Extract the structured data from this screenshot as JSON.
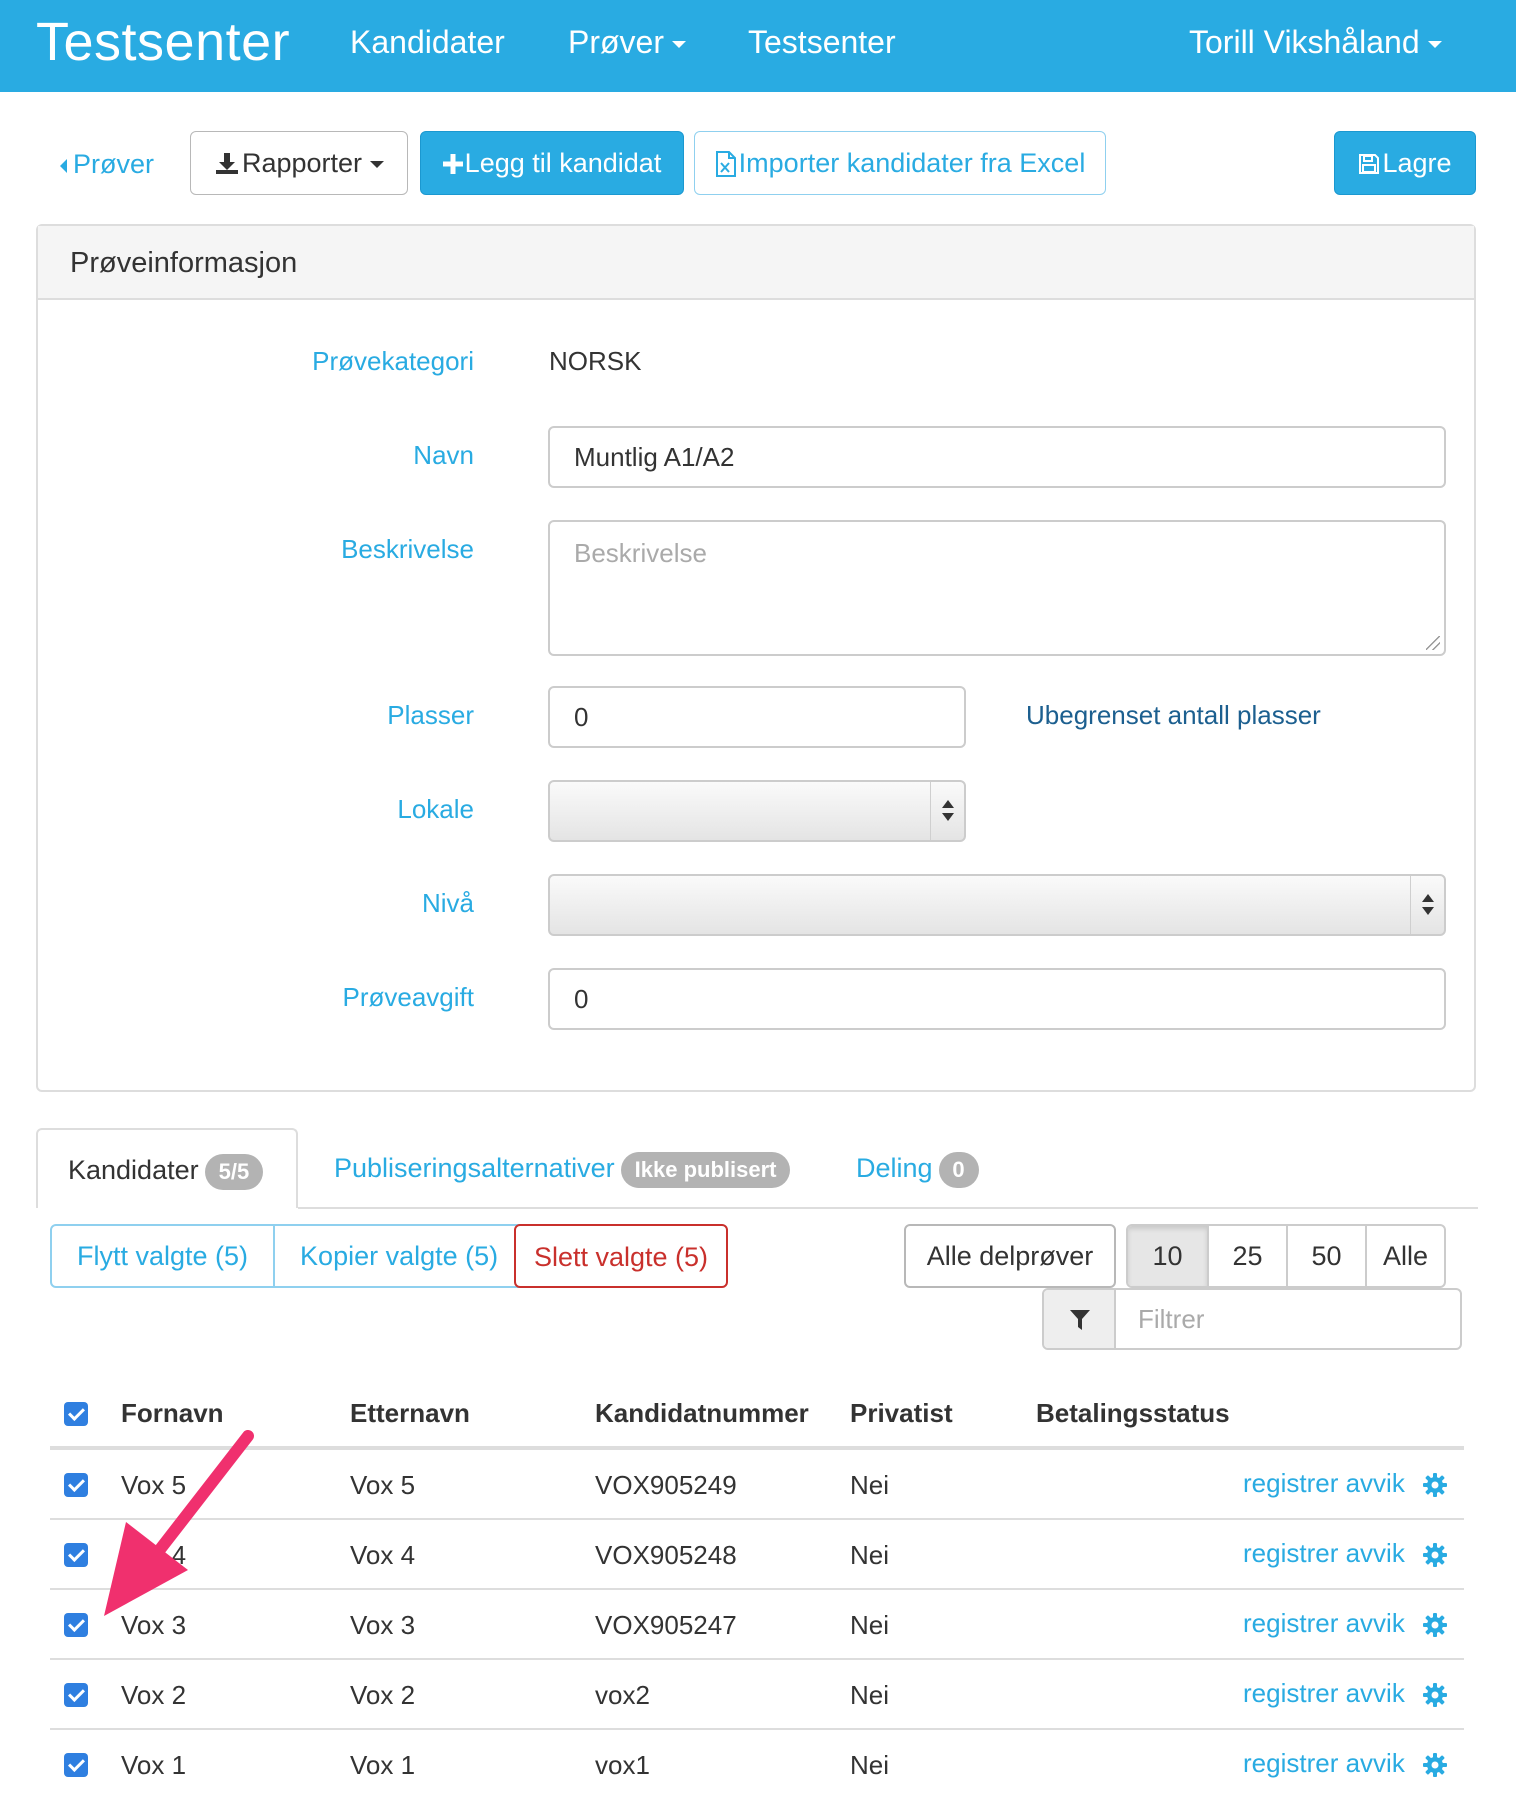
{
  "navbar": {
    "brand": "Testsenter",
    "items": [
      {
        "label": "Kandidater"
      },
      {
        "label": "Prøver"
      },
      {
        "label": "Testsenter"
      }
    ],
    "user": "Torill Vikshåland",
    "color": "#29abe2"
  },
  "toolbar": {
    "back": "Prøver",
    "reports": "Rapporter",
    "add_candidate": "Legg til kandidat",
    "import_excel": "Importer kandidater fra Excel",
    "save": "Lagre"
  },
  "panel": {
    "title": "Prøveinformasjon",
    "fields": {
      "category_label": "Prøvekategori",
      "category_value": "NORSK",
      "name_label": "Navn",
      "name_value": "Muntlig A1/A2",
      "description_label": "Beskrivelse",
      "description_placeholder": "Beskrivelse",
      "seats_label": "Plasser",
      "seats_value": "0",
      "unlimited_link": "Ubegrenset antall plasser",
      "location_label": "Lokale",
      "location_value": "",
      "level_label": "Nivå",
      "level_value": "",
      "fee_label": "Prøveavgift",
      "fee_value": "0"
    }
  },
  "tabs": [
    {
      "label": "Kandidater",
      "badge": "5/5",
      "active": true
    },
    {
      "label": "Publiseringsalternativer",
      "badge": "Ikke publisert",
      "active": false
    },
    {
      "label": "Deling",
      "badge": "0",
      "active": false
    }
  ],
  "actions": {
    "move": "Flytt valgte (5)",
    "copy": "Kopier valgte (5)",
    "delete": "Slett valgte (5)",
    "all_subtests": "Alle delprøver",
    "page_sizes": [
      "10",
      "25",
      "50",
      "Alle"
    ],
    "active_page_size": "10",
    "filter_placeholder": "Filtrer"
  },
  "table": {
    "columns": [
      "Fornavn",
      "Etternavn",
      "Kandidatnummer",
      "Privatist",
      "Betalingsstatus"
    ],
    "select_all_checked": true,
    "rows": [
      {
        "first": "Vox 5",
        "last": "Vox 5",
        "number": "VOX905249",
        "private": "Nei",
        "payment": "",
        "action": "registrer avvik",
        "checked": true
      },
      {
        "first": "Vox 4",
        "last": "Vox 4",
        "number": "VOX905248",
        "private": "Nei",
        "payment": "",
        "action": "registrer avvik",
        "checked": true
      },
      {
        "first": "Vox 3",
        "last": "Vox 3",
        "number": "VOX905247",
        "private": "Nei",
        "payment": "",
        "action": "registrer avvik",
        "checked": true
      },
      {
        "first": "Vox 2",
        "last": "Vox 2",
        "number": "vox2",
        "private": "Nei",
        "payment": "",
        "action": "registrer avvik",
        "checked": true
      },
      {
        "first": "Vox 1",
        "last": "Vox 1",
        "number": "vox1",
        "private": "Nei",
        "payment": "",
        "action": "registrer avvik",
        "checked": true
      }
    ]
  },
  "icons": {
    "download": "download-icon",
    "plus": "plus-icon",
    "excel": "excel-file-icon",
    "save": "floppy-disk-icon",
    "filter": "filter-icon",
    "settings": "gear-icon",
    "annotation": "arrow-annotation"
  },
  "colors": {
    "accent": "#29abe2",
    "danger": "#c9302c",
    "checkbox": "#2f7fe0",
    "annotation": "#f0306e"
  }
}
